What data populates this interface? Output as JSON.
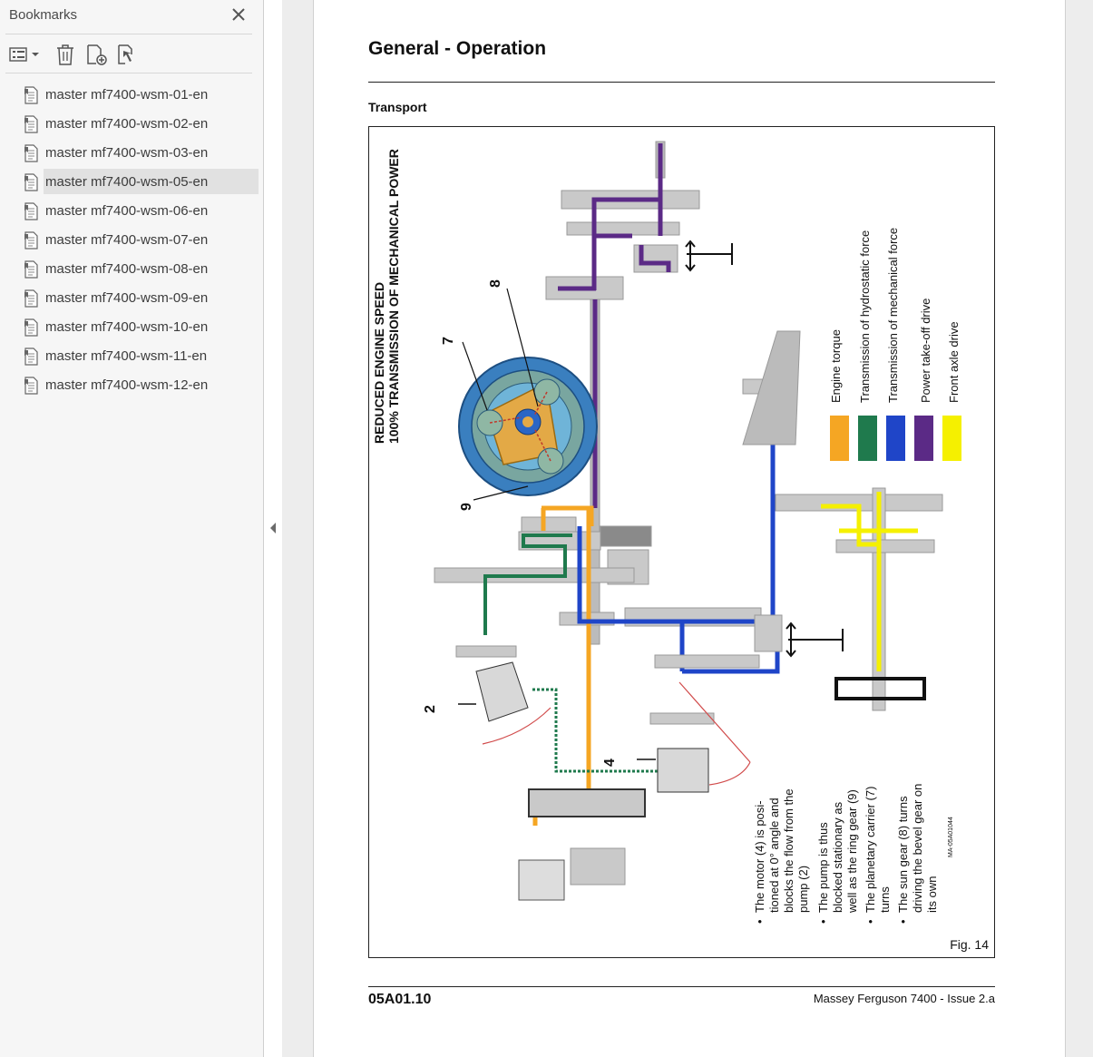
{
  "sidebar": {
    "title": "Bookmarks",
    "toolbar": {
      "options_icon": "list-options-icon",
      "delete_icon": "trash-icon",
      "add_icon": "add-bookmark-icon",
      "find_icon": "find-bookmark-icon"
    },
    "items": [
      {
        "label": "master mf7400-wsm-01-en"
      },
      {
        "label": "master mf7400-wsm-02-en"
      },
      {
        "label": "master mf7400-wsm-03-en"
      },
      {
        "label": "master mf7400-wsm-05-en",
        "selected": true
      },
      {
        "label": "master mf7400-wsm-06-en"
      },
      {
        "label": "master mf7400-wsm-07-en"
      },
      {
        "label": "master mf7400-wsm-08-en"
      },
      {
        "label": "master mf7400-wsm-09-en"
      },
      {
        "label": "master mf7400-wsm-10-en"
      },
      {
        "label": "master mf7400-wsm-11-en"
      },
      {
        "label": "master mf7400-wsm-12-en"
      }
    ]
  },
  "page": {
    "title": "General - Operation",
    "section": "Transport",
    "figure": {
      "heading_line1": "REDUCED ENGINE SPEED",
      "heading_line2": "100% TRANSMISSION OF MECHANICAL POWER",
      "callouts": [
        "7",
        "8",
        "9",
        "2",
        "4"
      ],
      "legend": [
        {
          "label": "Engine torque",
          "color": "#f5a623"
        },
        {
          "label": "Transmission of hydrostatic force",
          "color": "#1f7a4d"
        },
        {
          "label": "Transmission of mechanical force",
          "color": "#1f45c8"
        },
        {
          "label": "Power take-off drive",
          "color": "#5b2a86"
        },
        {
          "label": "Front axle drive",
          "color": "#f5f000"
        }
      ],
      "notes": [
        {
          "lines": [
            "The motor (4) is posi-",
            "tioned at 0° angle and",
            "blocks the flow from the",
            "pump (2)"
          ]
        },
        {
          "lines": [
            "The pump is thus",
            "blocked stationary as",
            "well as the ring gear (9)"
          ]
        },
        {
          "lines": [
            "The planetary carrier (7)",
            "turns"
          ]
        },
        {
          "lines": [
            "The sun gear (8) turns",
            "driving the bevel gear on",
            "its own"
          ]
        }
      ],
      "image_code": "MA-05A01044",
      "caption": "Fig. 14"
    },
    "footer_code": "05A01.10",
    "footer_issue": "Massey Ferguson 7400 - Issue 2.a"
  }
}
